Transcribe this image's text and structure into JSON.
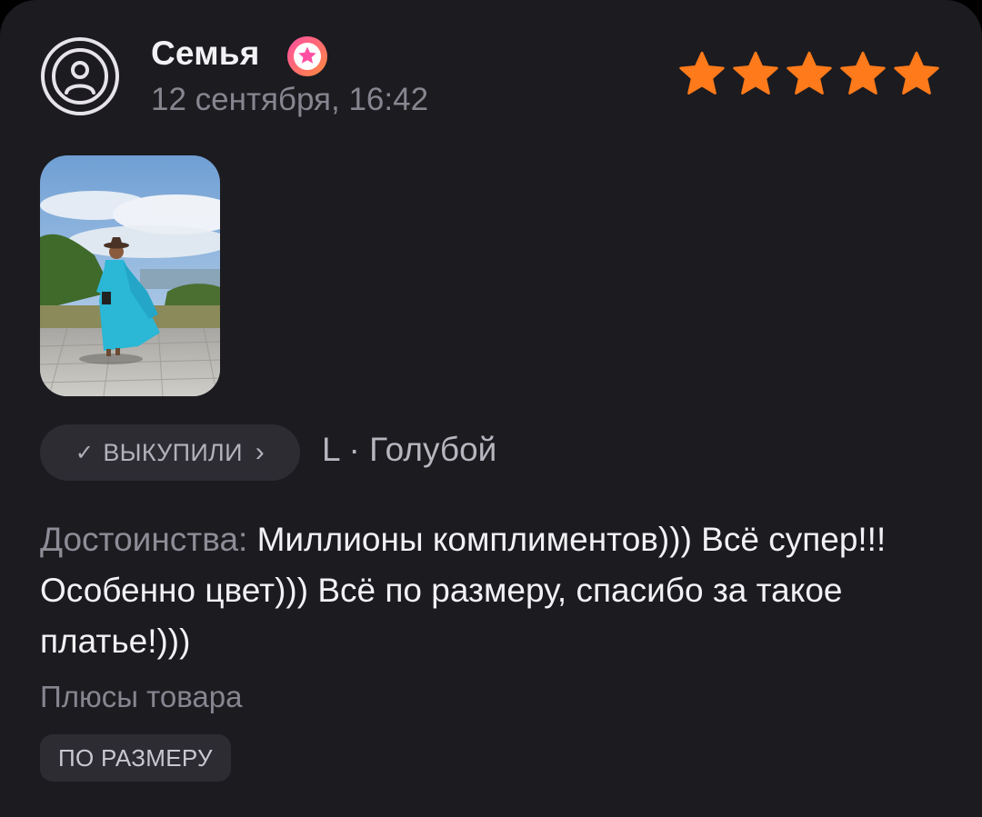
{
  "review": {
    "author": {
      "name": "Семья",
      "avatar_icon": "user-circle-icon",
      "badge_icon": "star-badge-icon"
    },
    "date": "12 сентября, 16:42",
    "rating": {
      "value": 5,
      "max": 5,
      "icon": "star-icon",
      "color": "#ff7a1a"
    },
    "photo": {
      "alt": "review-photo"
    },
    "purchase_chip": {
      "check_icon": "check-icon",
      "label": "ВЫКУПИЛИ",
      "chevron_icon": "chevron-right-icon"
    },
    "variant": "L · Голубой",
    "text": {
      "label": "Достоинства:",
      "body": " Миллионы комплиментов))) Всё супер!!! Особенно цвет))) Всё по размеру, спасибо за такое платье!)))"
    },
    "pluses": {
      "title": "Плюсы товара",
      "tags": [
        "ПО РАЗМЕРУ"
      ]
    }
  },
  "colors": {
    "card_bg": "#1c1b20",
    "chip_bg": "#2d2c33",
    "star": "#ff7a1a",
    "badge_gradient_start": "#ff4fa3",
    "badge_gradient_end": "#ff8a3d"
  }
}
